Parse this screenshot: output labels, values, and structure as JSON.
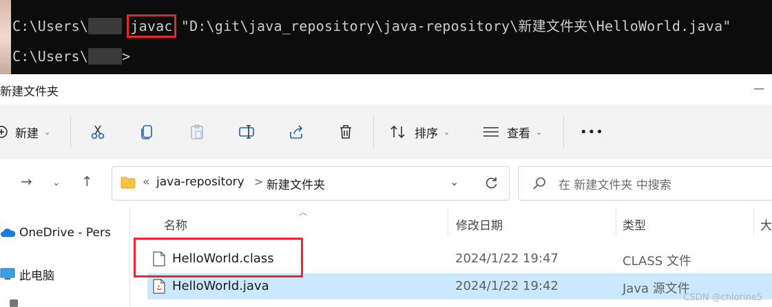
{
  "terminal": {
    "prompt_prefix": "C:\\Users\\",
    "command": "javac",
    "argument": "\"D:\\git\\java_repository\\java-repository\\新建文件夹\\HelloWorld.java\"",
    "prompt_suffix": ">",
    "line2_prefix": "C:\\Users\\"
  },
  "window": {
    "title": "新建文件夹"
  },
  "toolbar": {
    "new_label": "新建",
    "sort_label": "排序",
    "view_label": "查看",
    "more_label": "•••"
  },
  "address": {
    "overflow": "«",
    "crumb1": "java-repository",
    "crumb_sep": ">",
    "crumb2": "新建文件夹"
  },
  "search": {
    "placeholder": "在 新建文件夹 中搜索"
  },
  "nav_pane": {
    "items": [
      "OneDrive - Pers",
      "此电脑"
    ]
  },
  "columns": {
    "name": "名称",
    "date": "修改日期",
    "type": "类型",
    "size": "大"
  },
  "files": [
    {
      "name": "HelloWorld.class",
      "date": "2024/1/22 19:47",
      "type": "CLASS 文件"
    },
    {
      "name": "HelloWorld.java",
      "date": "2024/1/22 19:42",
      "type": "Java 源文件"
    }
  ],
  "watermark": "CSDN @chlorine5"
}
